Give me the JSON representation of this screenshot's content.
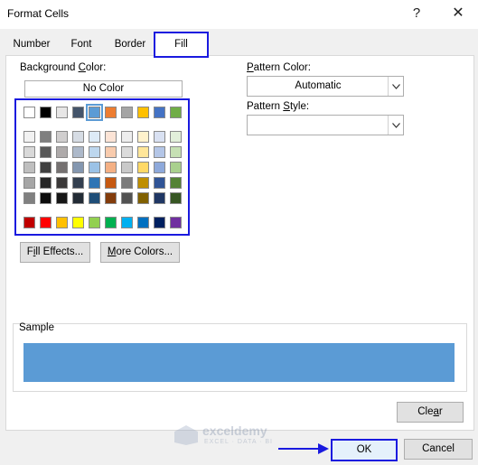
{
  "window": {
    "title": "Format Cells",
    "help_glyph": "?",
    "close_glyph": "✕"
  },
  "tabs": [
    {
      "label": "Number",
      "active": false
    },
    {
      "label": "Font",
      "active": false
    },
    {
      "label": "Border",
      "active": false
    },
    {
      "label": "Fill",
      "active": true
    }
  ],
  "fill": {
    "background_color_label": "Background Color:",
    "no_color_label": "No Color",
    "pattern_color_label": "Pattern Color:",
    "pattern_color_value": "Automatic",
    "pattern_style_label": "Pattern Style:",
    "pattern_style_value": "",
    "fill_effects_label": "Fill Effects...",
    "more_colors_label": "More Colors...",
    "selected_color": "#5b9bd5",
    "palette_theme_row": [
      "#ffffff",
      "#000000",
      "#e7e6e6",
      "#44546a",
      "#5b9bd5",
      "#ed7d31",
      "#a5a5a5",
      "#ffc000",
      "#4472c4",
      "#70ad47"
    ],
    "palette_tints": [
      [
        "#f2f2f2",
        "#7f7f7f",
        "#d0cece",
        "#d6dce4",
        "#ddebf7",
        "#fce4d6",
        "#ededed",
        "#fff2cc",
        "#d9e1f2",
        "#e2efda"
      ],
      [
        "#d9d9d9",
        "#595959",
        "#aeaaaa",
        "#adb9ca",
        "#bdd7ee",
        "#f8cbad",
        "#dbdbdb",
        "#ffe699",
        "#b4c6e7",
        "#c6e0b4"
      ],
      [
        "#bfbfbf",
        "#404040",
        "#757171",
        "#8497b0",
        "#9bc2e6",
        "#f4b084",
        "#c9c9c9",
        "#ffd966",
        "#8ea9db",
        "#a9d08e"
      ],
      [
        "#a6a6a6",
        "#262626",
        "#3a3838",
        "#333f4f",
        "#2f75b5",
        "#c65911",
        "#7b7b7b",
        "#bf8f00",
        "#305496",
        "#548235"
      ],
      [
        "#808080",
        "#0d0d0d",
        "#161616",
        "#222b35",
        "#1f4e78",
        "#833c0c",
        "#525252",
        "#806000",
        "#203764",
        "#375623"
      ]
    ],
    "palette_standard": [
      "#c00000",
      "#ff0000",
      "#ffc000",
      "#ffff00",
      "#92d050",
      "#00b050",
      "#00b0f0",
      "#0070c0",
      "#002060",
      "#7030a0"
    ]
  },
  "sample": {
    "label": "Sample"
  },
  "buttons": {
    "clear": "Clear",
    "ok": "OK",
    "cancel": "Cancel"
  },
  "watermark": {
    "name": "exceldemy",
    "tagline": "EXCEL · DATA · BI"
  },
  "annotation_color": "#1a1adf"
}
